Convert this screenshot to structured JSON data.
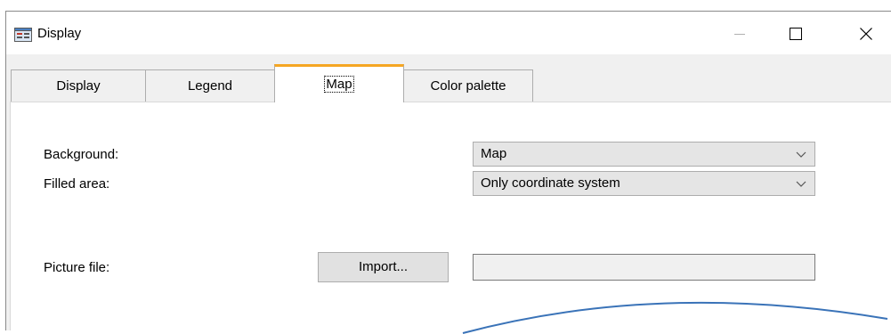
{
  "window": {
    "title": "Display",
    "icons": {
      "app": "display-window-icon",
      "minimize": "minimize-icon",
      "maximize": "maximize-icon",
      "close": "close-icon"
    }
  },
  "tabs": [
    {
      "label": "Display",
      "active": false
    },
    {
      "label": "Legend",
      "active": false
    },
    {
      "label": "Map",
      "active": true
    },
    {
      "label": "Color palette",
      "active": false
    }
  ],
  "form": {
    "background_label": "Background:",
    "background_value": "Map",
    "filled_area_label": "Filled area:",
    "filled_area_value": "Only coordinate system",
    "picture_file_label": "Picture file:",
    "import_button": "Import...",
    "picture_file_value": ""
  },
  "colors": {
    "active_tab_accent": "#f5a623",
    "map_outline": "#3a73b8"
  }
}
